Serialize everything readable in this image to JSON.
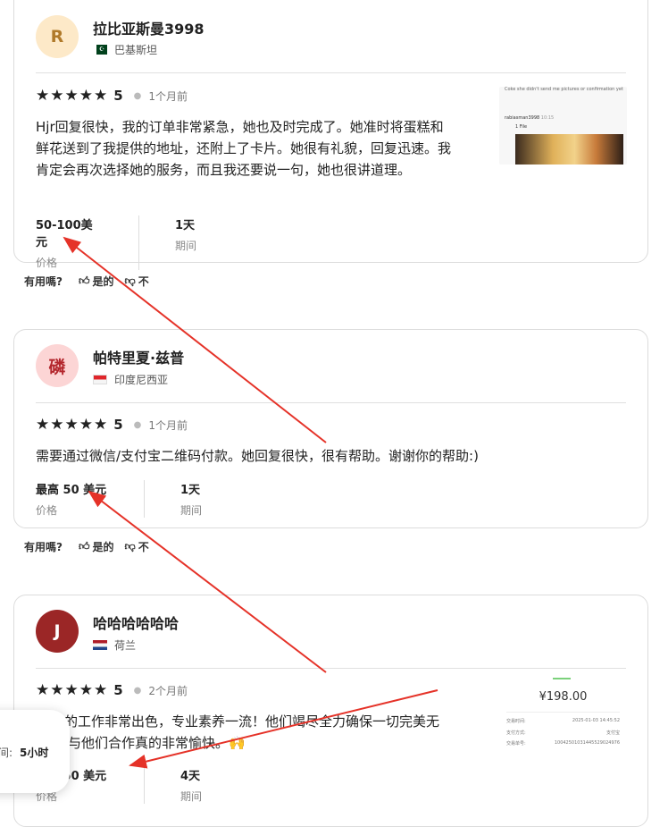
{
  "reviews": [
    {
      "avatar_letter": "R",
      "name": "拉比亚斯曼3998",
      "country": "巴基斯坦",
      "score": "5",
      "stars": "★★★★★",
      "time_ago": "1个月前",
      "text": "Hjr回复很快，我的订单非常紧急，她也及时完成了。她准时将蛋糕和鲜花送到了我提供的地址，还附上了卡片。她很有礼貌，回复迅速。我肯定会再次选择她的服务，而且我还要说一句，她也很讲道理。",
      "price_value": "50-100美元",
      "price_label": "价格",
      "duration_value": "1天",
      "duration_label": "期间",
      "attachment": {
        "line1": "Coke she didn't send me pictures or confirmation yet",
        "sender": "rabiasman3998",
        "time": "10:15",
        "file": "1 File"
      }
    },
    {
      "avatar_letter": "磷",
      "name": "帕特里夏·兹普",
      "country": "印度尼西亚",
      "score": "5",
      "stars": "★★★★★",
      "time_ago": "1个月前",
      "text": "需要通过微信/支付宝二维码付款。她回复很快，很有帮助。谢谢你的帮助:)",
      "price_value": "最高 50 美元",
      "price_label": "价格",
      "duration_value": "1天",
      "duration_label": "期间"
    },
    {
      "avatar_letter": "J",
      "name": "哈哈哈哈哈哈",
      "country": "荷兰",
      "score": "5",
      "stars": "★★★★★",
      "time_ago": "2个月前",
      "text_line1": "的工作非常出色，专业素养一流！他们竭尽全力确保一切完美无",
      "text_line2": "与他们合作真的非常愉快。🙌",
      "price_value": "最高 50 美元",
      "price_label": "价格",
      "duration_value": "4天",
      "duration_label": "期间",
      "receipt": {
        "amount": "¥198.00",
        "row1_label": "交易时间:",
        "row1_value": "2025-01-03 14:45:52",
        "row2_label": "支付方式:",
        "row2_value": "支付宝",
        "row3_label": "交易单号:",
        "row3_value": "10042501031445529024976"
      }
    }
  ],
  "helpful": {
    "label": "有用嗎?",
    "yes": "是的",
    "no": "不"
  },
  "tooltip": {
    "label": "间:",
    "value": "5小时"
  },
  "colors": {
    "arrow": "#e53228",
    "star": "#222222"
  }
}
